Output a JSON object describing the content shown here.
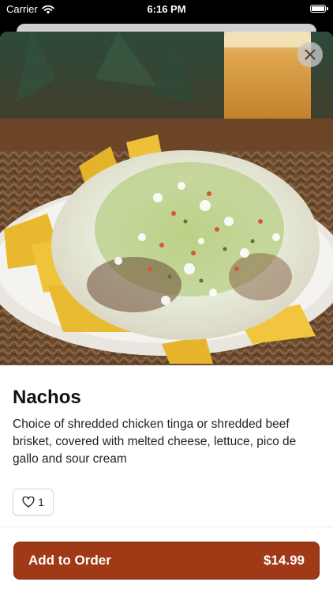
{
  "status_bar": {
    "carrier": "Carrier",
    "time": "6:16 PM"
  },
  "item": {
    "name": "Nachos",
    "description": "Choice of shredded chicken tinga or shredded beef brisket, covered with melted cheese, lettuce, pico de gallo and sour cream",
    "likes": "1",
    "photo_icon": "nachos-photo"
  },
  "actions": {
    "add_label": "Add to Order",
    "price": "$14.99"
  },
  "colors": {
    "accent": "#a03916"
  }
}
